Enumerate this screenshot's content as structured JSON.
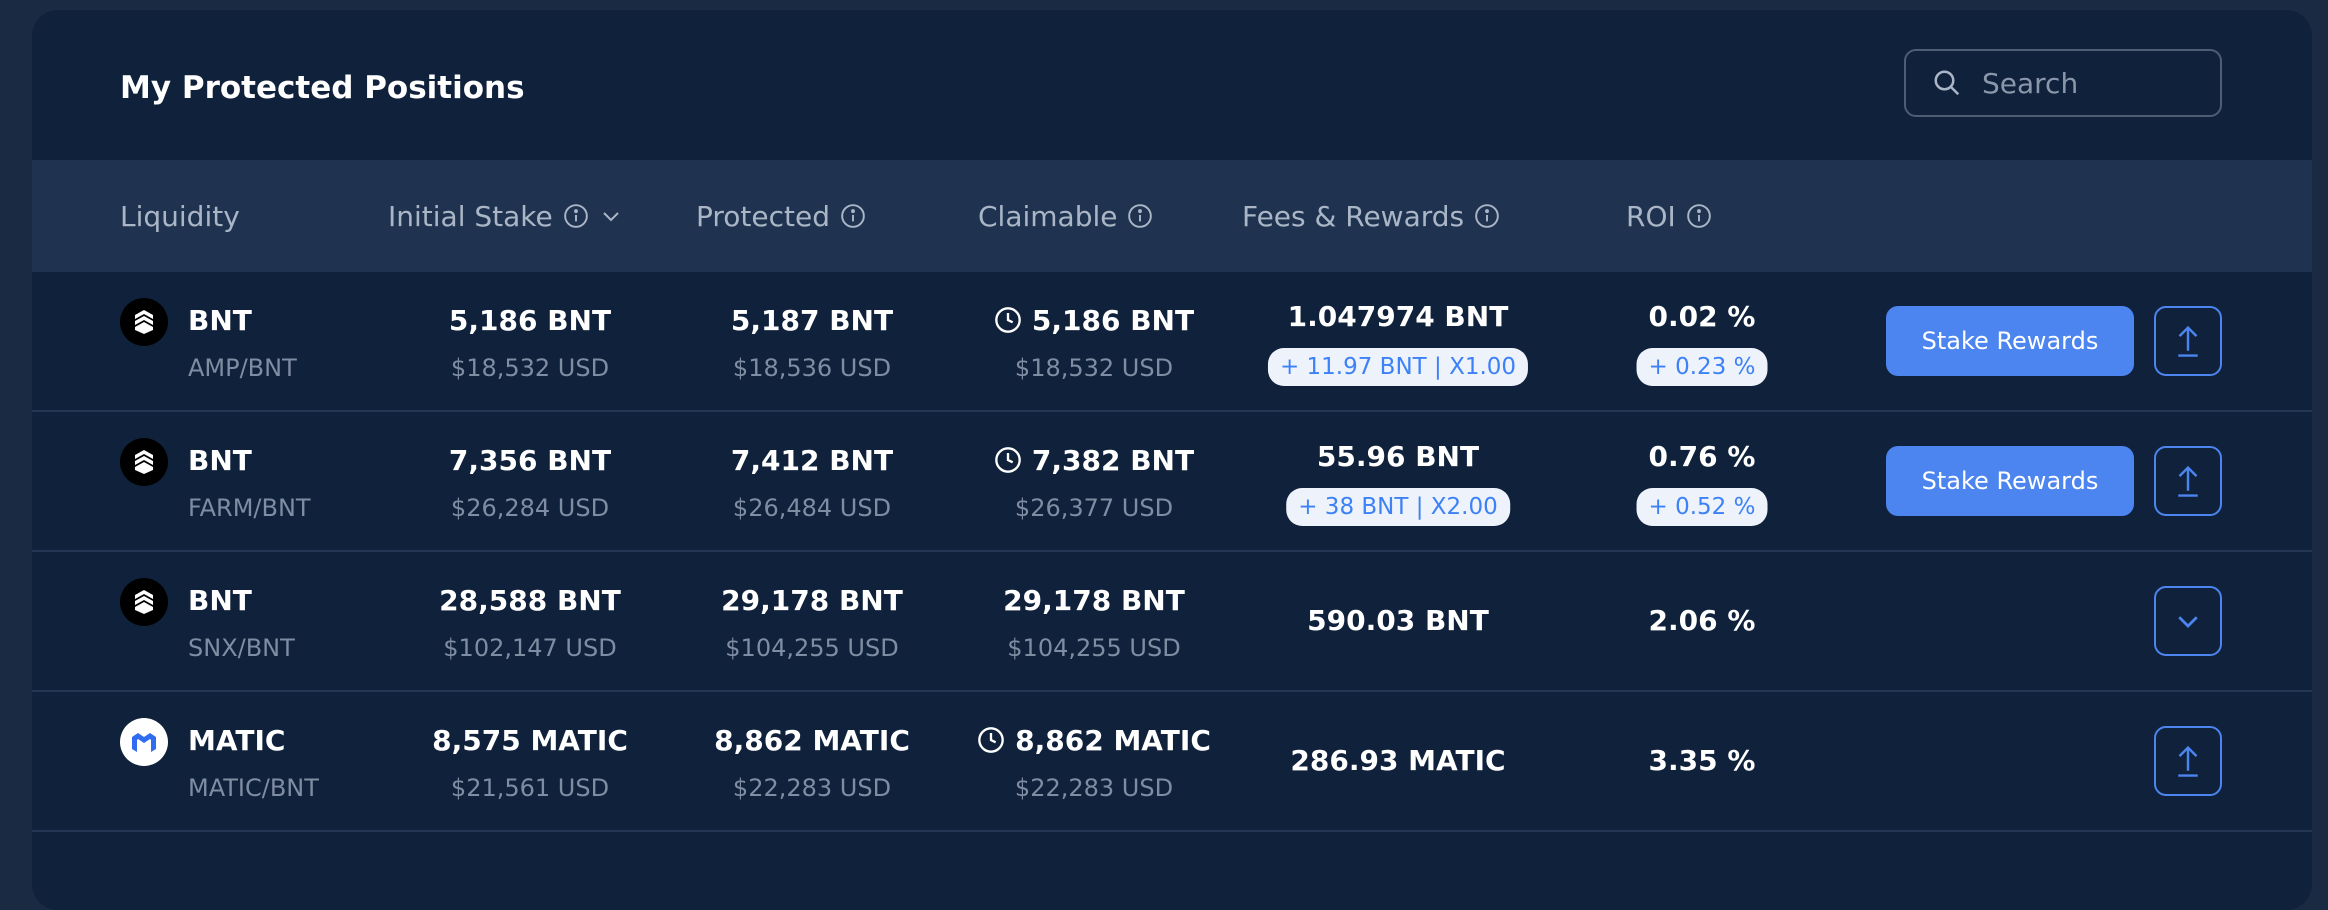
{
  "header": {
    "title": "My Protected Positions",
    "search_placeholder": "Search"
  },
  "columns": {
    "liquidity": "Liquidity",
    "initial_stake": "Initial Stake",
    "protected": "Protected",
    "claimable": "Claimable",
    "fees_rewards": "Fees & Rewards",
    "roi": "ROI"
  },
  "rows": [
    {
      "token": "BNT",
      "icon": "bancor-icon",
      "pair": "AMP/BNT",
      "initial_stake": "5,186 BNT",
      "initial_stake_usd": "$18,532 USD",
      "protected": "5,187 BNT",
      "protected_usd": "$18,536 USD",
      "claimable": "5,186 BNT",
      "claimable_usd": "$18,532 USD",
      "fees": "1.047974 BNT",
      "fees_badge": "+ 11.97 BNT | X1.00",
      "roi": "0.02 %",
      "roi_badge": "+ 0.23 %",
      "stake_button": "Stake Rewards",
      "action_icon": "upload-icon"
    },
    {
      "token": "BNT",
      "icon": "bancor-icon",
      "pair": "FARM/BNT",
      "initial_stake": "7,356 BNT",
      "initial_stake_usd": "$26,284 USD",
      "protected": "7,412 BNT",
      "protected_usd": "$26,484 USD",
      "claimable": "7,382 BNT",
      "claimable_usd": "$26,377 USD",
      "fees": "55.96 BNT",
      "fees_badge": "+ 38 BNT | X2.00",
      "roi": "0.76 %",
      "roi_badge": "+ 0.52 %",
      "stake_button": "Stake Rewards",
      "action_icon": "upload-icon"
    },
    {
      "token": "BNT",
      "icon": "bancor-icon",
      "pair": "SNX/BNT",
      "initial_stake": "28,588 BNT",
      "initial_stake_usd": "$102,147 USD",
      "protected": "29,178 BNT",
      "protected_usd": "$104,255 USD",
      "claimable": "29,178 BNT",
      "claimable_usd": "$104,255 USD",
      "fees": "590.03 BNT",
      "roi": "2.06 %",
      "action_icon": "chevron-down-icon"
    },
    {
      "token": "MATIC",
      "icon": "polygon-icon",
      "pair": "MATIC/BNT",
      "initial_stake": "8,575 MATIC",
      "initial_stake_usd": "$21,561 USD",
      "protected": "8,862 MATIC",
      "protected_usd": "$22,283 USD",
      "claimable": "8,862 MATIC",
      "claimable_usd": "$22,283 USD",
      "fees": "286.93 MATIC",
      "roi": "3.35 %",
      "action_icon": "upload-icon"
    }
  ],
  "colors": {
    "background": "#1a2a42",
    "panel": "#0f213b",
    "header_row": "#1f3350",
    "accent": "#4c85f0",
    "muted_text": "#7f8da2"
  }
}
